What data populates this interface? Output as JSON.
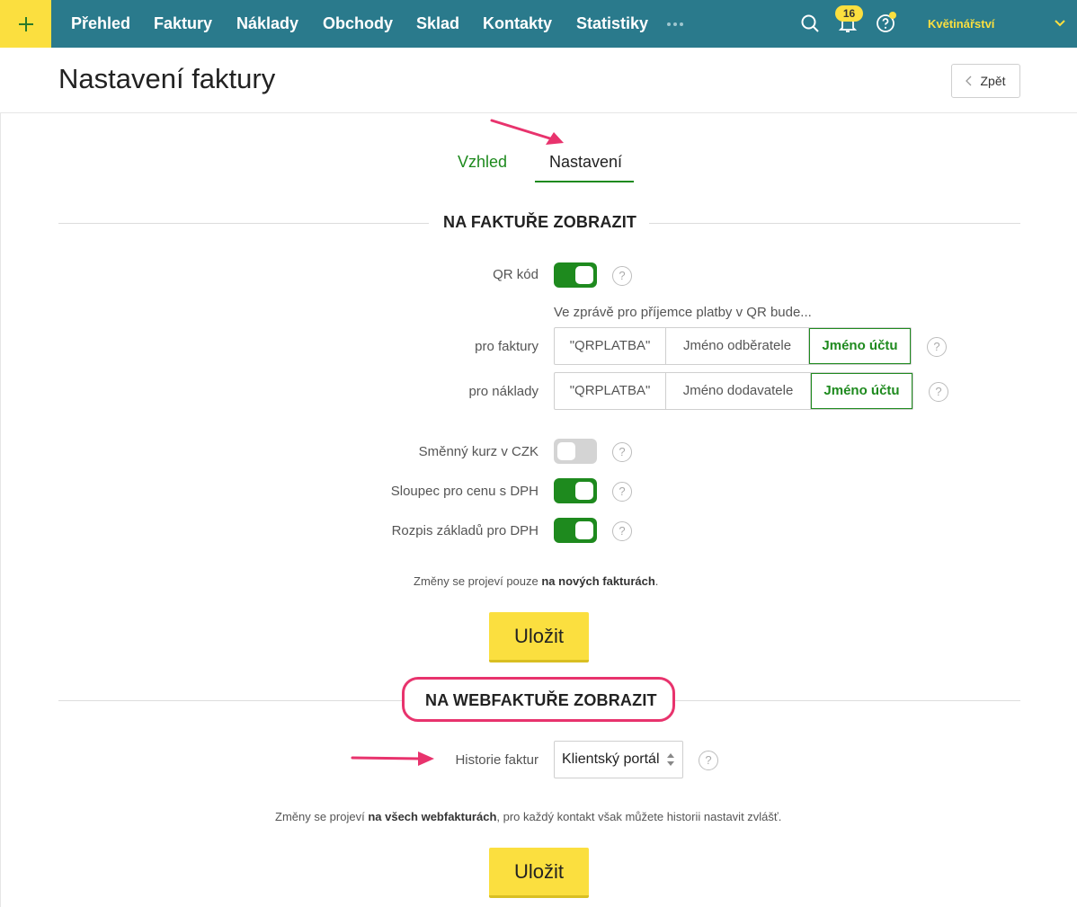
{
  "nav": {
    "items": [
      "Přehled",
      "Faktury",
      "Náklady",
      "Obchody",
      "Sklad",
      "Kontakty",
      "Statistiky"
    ],
    "notification_count": "16",
    "company": "Květinářství",
    "icons": [
      "plus-icon",
      "more-dots-icon",
      "search-icon",
      "bell-icon",
      "help-icon",
      "chevron-down-icon"
    ],
    "colors": {
      "bar": "#2a7a8c",
      "accent": "#fbdf3f"
    }
  },
  "header": {
    "title": "Nastavení faktury",
    "back_label": "Zpět"
  },
  "tabs": [
    {
      "label": "Vzhled",
      "active": false
    },
    {
      "label": "Nastavení",
      "active": true
    }
  ],
  "invoice_section": {
    "title": "NA FAKTUŘE ZOBRAZIT",
    "qr_label": "QR kód",
    "qr_on": true,
    "qr_info": "Ve zprávě pro příjemce platby v QR bude...",
    "for_invoices": {
      "label": "pro faktury",
      "options": [
        "\"QRPLATBA\"",
        "Jméno odběratele",
        "Jméno účtu"
      ],
      "selected": "Jméno účtu"
    },
    "for_costs": {
      "label": "pro náklady",
      "options": [
        "\"QRPLATBA\"",
        "Jméno dodavatele",
        "Jméno účtu"
      ],
      "selected": "Jméno účtu"
    },
    "toggles": [
      {
        "label": "Směnný kurz v CZK",
        "on": false
      },
      {
        "label": "Sloupec pro cenu s DPH",
        "on": true
      },
      {
        "label": "Rozpis základů pro DPH",
        "on": true
      }
    ],
    "note_before": "Změny se projeví pouze ",
    "note_bold": "na nových fakturách",
    "note_after": ".",
    "save_label": "Uložit"
  },
  "webinvoice_section": {
    "title": "NA WEBFAKTUŘE ZOBRAZIT",
    "history_label": "Historie faktur",
    "history_value": "Klientský portál",
    "note_before": "Změny se projeví ",
    "note_bold": "na všech webfakturách",
    "note_after": ", pro každý kontakt však můžete historii nastavit zvlášť.",
    "save_label": "Uložit"
  },
  "help_glyph": "?",
  "highlight_color": "#e8336d",
  "toggle_on_color": "#1e8a1e"
}
